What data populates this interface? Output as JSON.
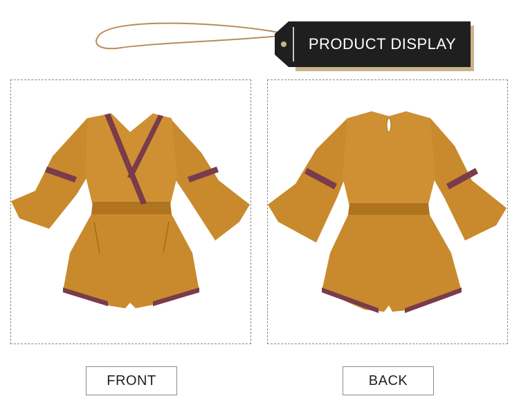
{
  "header": {
    "title": "PRODUCT DISPLAY"
  },
  "panels": {
    "front": {
      "caption": "FRONT",
      "garment": "romper-front"
    },
    "back": {
      "caption": "BACK",
      "garment": "romper-back"
    }
  },
  "colors": {
    "fabric": "#c98a2e",
    "fabric_shadow": "#b0731f",
    "trim": "#7a3b4a",
    "tag": "#1f1f1f",
    "tag_accent": "#c9b48a",
    "string": "#b88a5a"
  }
}
